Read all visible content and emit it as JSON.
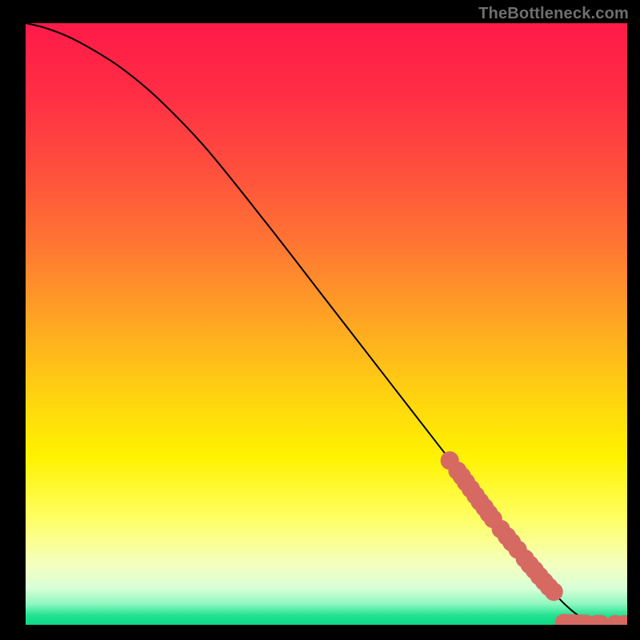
{
  "watermark": "TheBottleneck.com",
  "chart_data": {
    "type": "line",
    "title": "",
    "xlabel": "",
    "ylabel": "",
    "xlim": [
      0,
      100
    ],
    "ylim": [
      0,
      100
    ],
    "grid": false,
    "legend": false,
    "background_gradient": {
      "direction": "vertical",
      "stops": [
        {
          "pos": 0.0,
          "color": "#ff1a48"
        },
        {
          "pos": 0.12,
          "color": "#ff2e45"
        },
        {
          "pos": 0.25,
          "color": "#ff513d"
        },
        {
          "pos": 0.38,
          "color": "#ff7a32"
        },
        {
          "pos": 0.5,
          "color": "#ffa722"
        },
        {
          "pos": 0.62,
          "color": "#ffd310"
        },
        {
          "pos": 0.72,
          "color": "#fff200"
        },
        {
          "pos": 0.82,
          "color": "#ffff60"
        },
        {
          "pos": 0.9,
          "color": "#f4ffbf"
        },
        {
          "pos": 0.94,
          "color": "#d7ffd7"
        },
        {
          "pos": 0.965,
          "color": "#8ff7c0"
        },
        {
          "pos": 0.985,
          "color": "#1ee28f"
        },
        {
          "pos": 1.0,
          "color": "#0fd885"
        }
      ]
    },
    "series": [
      {
        "name": "curve",
        "type": "line",
        "color": "#000000",
        "x": [
          0,
          3,
          7,
          11,
          16,
          22,
          30,
          40,
          50,
          60,
          70,
          78,
          84,
          88,
          91,
          93,
          96,
          100
        ],
        "y": [
          100,
          99.3,
          97.8,
          95.7,
          92.5,
          87.5,
          79.2,
          66.8,
          53.9,
          41.0,
          28.1,
          17.8,
          10.1,
          5.1,
          2.2,
          1.0,
          0.3,
          0.1
        ]
      },
      {
        "name": "points-on-curve",
        "type": "scatter",
        "color": "#d66a63",
        "marker_size": 11,
        "x": [
          70.5,
          71.8,
          72.5,
          73.2,
          74.0,
          74.8,
          75.5,
          76.3,
          77.0,
          77.7,
          79.0,
          80.0,
          80.8,
          81.8,
          83.0,
          83.8,
          84.6,
          85.4,
          86.2,
          87.0,
          87.8
        ],
        "y": [
          27.3,
          25.6,
          24.7,
          23.7,
          22.6,
          21.5,
          20.5,
          19.5,
          18.5,
          17.6,
          15.9,
          14.7,
          13.7,
          12.5,
          11.0,
          10.0,
          9.1,
          8.1,
          7.2,
          6.3,
          5.5
        ]
      },
      {
        "name": "points-flat",
        "type": "scatter",
        "color": "#d66a63",
        "marker_size": 11,
        "x": [
          89.5,
          90.2,
          90.8,
          91.4,
          92.0,
          92.6,
          93.2,
          95.0,
          95.6,
          98.0,
          99.5
        ],
        "y": [
          0.3,
          0.25,
          0.22,
          0.2,
          0.18,
          0.16,
          0.14,
          0.12,
          0.11,
          0.09,
          0.08
        ]
      }
    ]
  }
}
